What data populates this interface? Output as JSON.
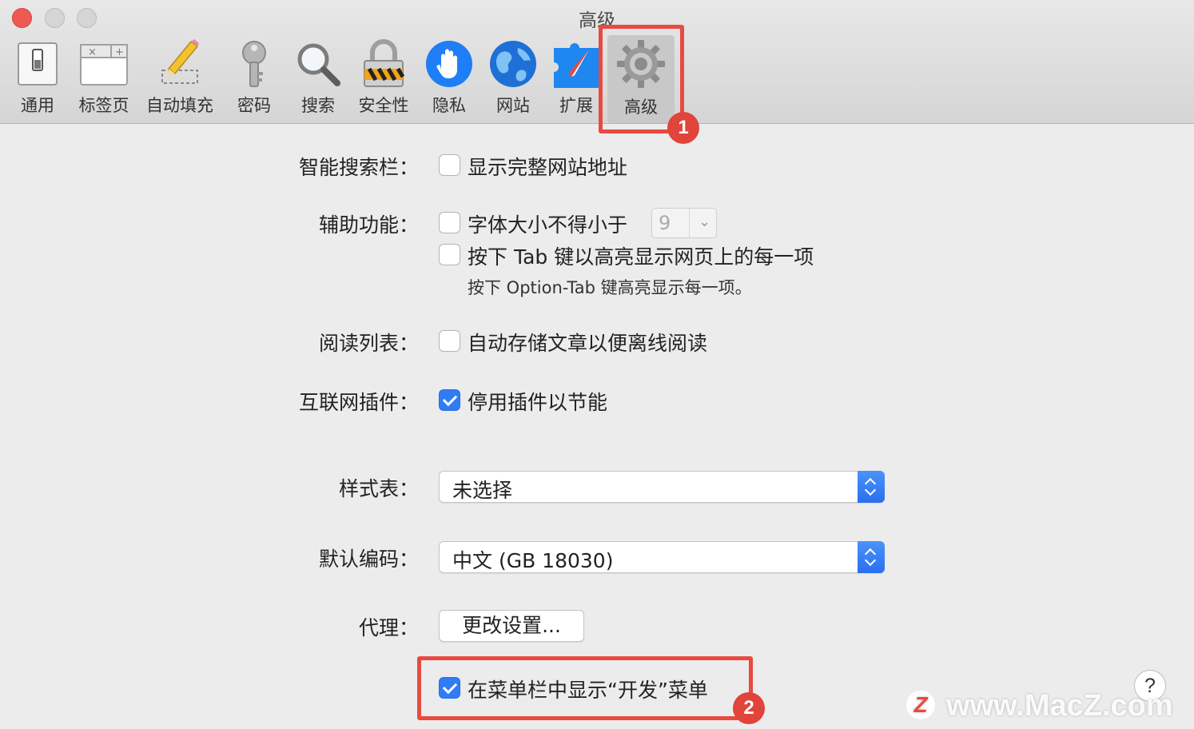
{
  "window": {
    "title": "高级"
  },
  "toolbar": {
    "items": [
      {
        "label": "通用",
        "icon": "general-switch-icon"
      },
      {
        "label": "标签页",
        "icon": "tabs-window-icon"
      },
      {
        "label": "自动填充",
        "icon": "pencil-icon"
      },
      {
        "label": "密码",
        "icon": "key-icon"
      },
      {
        "label": "搜索",
        "icon": "magnifier-icon"
      },
      {
        "label": "安全性",
        "icon": "padlock-icon"
      },
      {
        "label": "隐私",
        "icon": "hand-icon"
      },
      {
        "label": "网站",
        "icon": "globe-icon"
      },
      {
        "label": "扩展",
        "icon": "puzzle-icon"
      },
      {
        "label": "高级",
        "icon": "gear-icon"
      }
    ],
    "selected": "高级"
  },
  "annotations": {
    "badge1": "1",
    "badge2": "2",
    "color": "#e94a40"
  },
  "settings": {
    "smart_search": {
      "label": "智能搜索栏：",
      "option": "显示完整网站地址",
      "checked": false
    },
    "accessibility": {
      "label": "辅助功能：",
      "min_font_option": "字体大小不得小于",
      "min_font_checked": false,
      "min_font_value": "9",
      "tab_option": "按下 Tab 键以高亮显示网页上的每一项",
      "tab_checked": false,
      "tab_note": "按下 Option-Tab 键高亮显示每一项。"
    },
    "reading_list": {
      "label": "阅读列表：",
      "option": "自动存储文章以便离线阅读",
      "checked": false
    },
    "plugins": {
      "label": "互联网插件：",
      "option": "停用插件以节能",
      "checked": true
    },
    "stylesheet": {
      "label": "样式表：",
      "value": "未选择"
    },
    "encoding": {
      "label": "默认编码：",
      "value": "中文 (GB 18030)"
    },
    "proxy": {
      "label": "代理：",
      "button": "更改设置..."
    },
    "develop_menu": {
      "option": "在菜单栏中显示“开发”菜单",
      "checked": true
    },
    "help": "?"
  },
  "watermark": {
    "logo": "Z",
    "text": "www.MacZ.com"
  },
  "colors": {
    "accent": "#2f7cf6",
    "toolbar_bg": "#dcdcdc",
    "window_bg": "#ececec"
  }
}
